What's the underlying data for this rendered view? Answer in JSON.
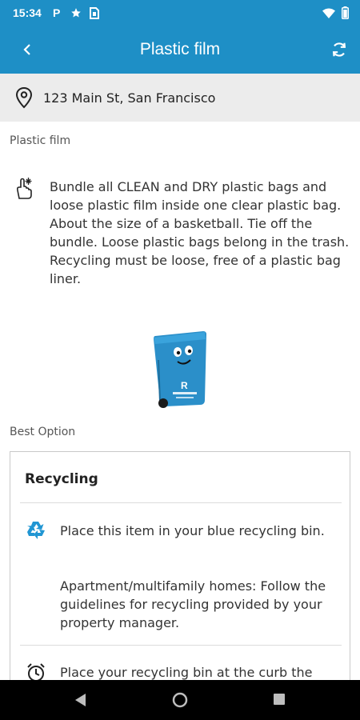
{
  "status_bar": {
    "time": "15:34",
    "icons": [
      "parking-p-icon",
      "star-icon",
      "sim-card-icon",
      "wifi-icon",
      "battery-icon"
    ]
  },
  "app_bar": {
    "title": "Plastic film",
    "back_icon": "chevron-left-icon",
    "refresh_icon": "refresh-icon",
    "background": "#1e8fc6"
  },
  "address": {
    "icon": "location-pin-icon",
    "text": "123 Main St, San Francisco"
  },
  "item": {
    "section_label": "Plastic film",
    "icon": "hand-gesture-icon",
    "instruction": "Bundle all CLEAN and DRY plastic bags and loose plastic film inside one clear plastic bag. About the size of a basketball. Tie off the bundle. Loose plastic bags belong in the trash. Recycling must be loose,  free of a plastic bag liner.",
    "bin_image": "blue-recycling-bin-mascot",
    "bin_logo_letter": "R"
  },
  "best_option": {
    "label": "Best Option",
    "card": {
      "title": "Recycling",
      "rows": [
        {
          "icon": "recycle-icon",
          "paragraphs": [
            "Place this item in your blue recycling bin.",
            "Apartment/multifamily homes: Follow the guidelines for recycling provided by your property manager."
          ]
        },
        {
          "icon": "alarm-clock-icon",
          "paragraphs": [
            "Place your recycling bin at the curb the"
          ]
        }
      ]
    }
  },
  "nav_bar": {
    "buttons": [
      "back-triangle-icon",
      "home-circle-icon",
      "recents-square-icon"
    ]
  }
}
